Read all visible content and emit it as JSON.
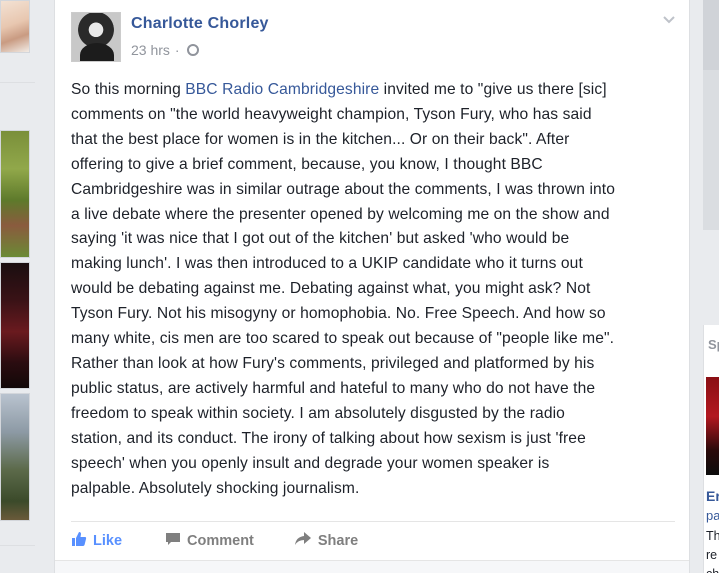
{
  "post": {
    "author": "Charlotte Chorley",
    "time": "23 hrs",
    "separator": "·",
    "body_lines": [
      {
        "pre": "So this morning ",
        "link": "BBC Radio Cambridgeshire",
        "post": " invited me to \"give us there [sic]"
      },
      {
        "pre": "comments on \"the world heavyweight champion, Tyson Fury, who has said"
      },
      {
        "pre": "that the best place for women is in the kitchen... Or on their back\". After"
      },
      {
        "pre": "offering to give a brief comment, because, you know, I thought BBC"
      },
      {
        "pre": "Cambridgeshire was in similar outrage about the comments, I was thrown into"
      },
      {
        "pre": "a live debate where the presenter opened by welcoming me on the show and"
      },
      {
        "pre": "saying 'it was nice that I got out of the kitchen' but asked 'who would be"
      },
      {
        "pre": "making lunch'. I was then introduced to a UKIP candidate who it turns out"
      },
      {
        "pre": "would be debating against me. Debating against what, you might ask? Not"
      },
      {
        "pre": "Tyson Fury. Not his misogyny or homophobia. No. Free Speech. And how so"
      },
      {
        "pre": "many white, cis men are too scared to speak out because of \"people like me\"."
      },
      {
        "pre": "Rather than look at how Fury's comments, privileged and platformed by his"
      },
      {
        "pre": "public status, are actively harmful and hateful to many who do not have the"
      },
      {
        "pre": "freedom to speak within society. I am absolutely disgusted by the radio"
      },
      {
        "pre": "station, and its conduct. The irony of talking about how sexism is just 'free"
      },
      {
        "pre": "speech' when you openly insult and degrade your women speaker is"
      },
      {
        "pre": "palpable. Absolutely shocking journalism."
      }
    ],
    "actions": {
      "like": "Like",
      "comment": "Comment",
      "share": "Share"
    }
  },
  "right_panel": {
    "heading": "Sp",
    "title": "Er",
    "subtitle": "pa",
    "text_lines": [
      "Th",
      "re",
      "ch"
    ]
  },
  "colors": {
    "link": "#365899",
    "like": "#5890ff",
    "text": "#1d2129",
    "muted": "#90949c"
  },
  "icons": [
    "globe-icon",
    "chevron-down-icon",
    "like-icon",
    "comment-icon",
    "share-icon"
  ]
}
